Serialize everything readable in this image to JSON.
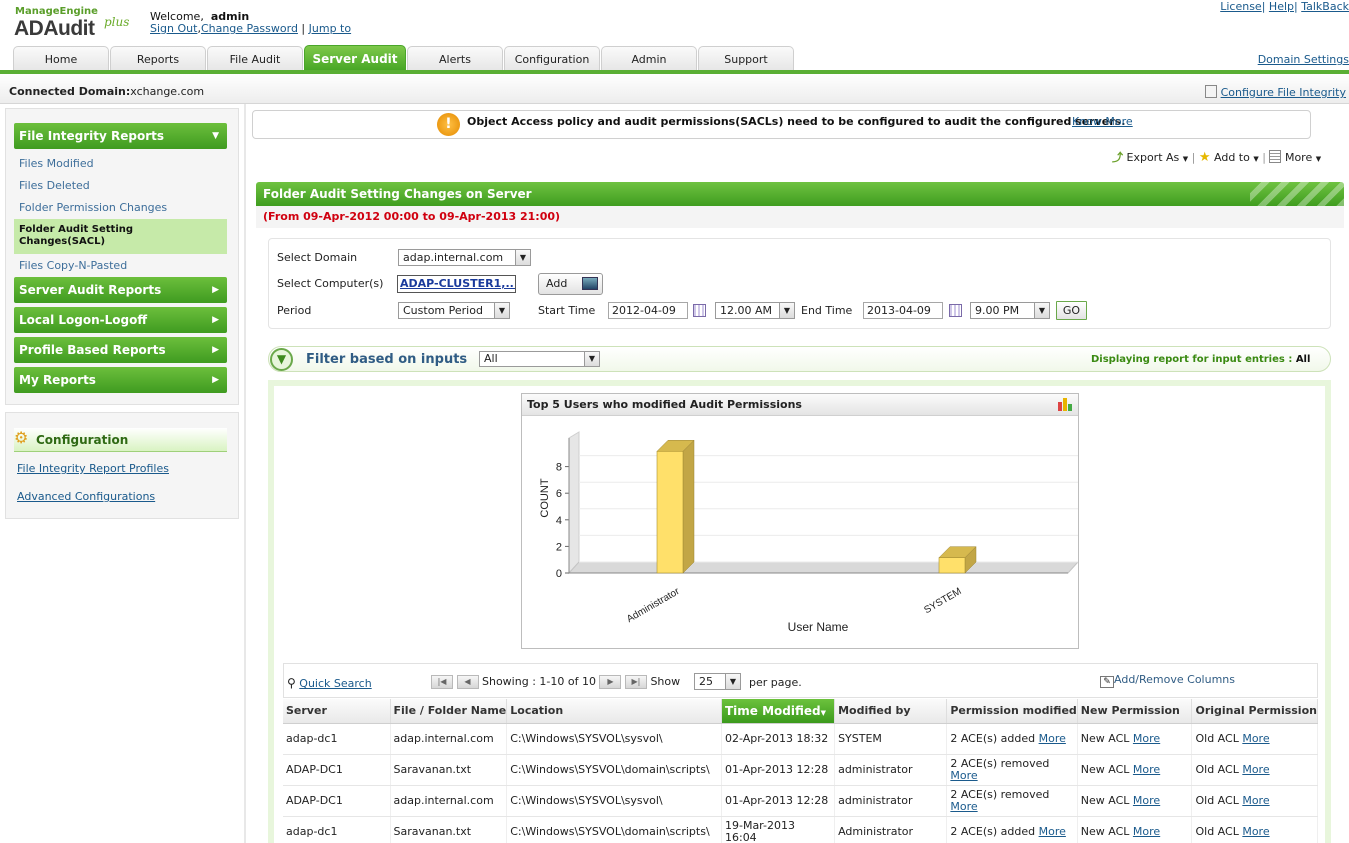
{
  "header": {
    "brand_top": "ManageEngine",
    "brand_main": "ADAudit",
    "brand_plus": "plus",
    "welcome_label": "Welcome,",
    "username": "admin",
    "sign_out": "Sign Out",
    "change_password": "Change Password",
    "jump_to": "Jump to",
    "license": "License",
    "help": "Help",
    "talkback": "TalkBack",
    "domain_settings": "Domain Settings"
  },
  "tabs": [
    {
      "label": "Home"
    },
    {
      "label": "Reports"
    },
    {
      "label": "File Audit"
    },
    {
      "label": "Server Audit",
      "active": true
    },
    {
      "label": "Alerts"
    },
    {
      "label": "Configuration"
    },
    {
      "label": "Admin"
    },
    {
      "label": "Support"
    }
  ],
  "connbar": {
    "label": "Connected Domain:",
    "domain": "xchange.com",
    "configure_link": "Configure File Integrity"
  },
  "sidebar": {
    "file_integrity_header": "File Integrity Reports",
    "items": [
      {
        "label": "Files Modified"
      },
      {
        "label": "Files Deleted"
      },
      {
        "label": "Folder Permission Changes"
      },
      {
        "label": "Folder Audit Setting Changes(SACL)",
        "selected": true
      },
      {
        "label": "Files Copy-N-Pasted"
      }
    ],
    "sections": [
      {
        "label": "Server Audit Reports"
      },
      {
        "label": "Local Logon-Logoff"
      },
      {
        "label": "Profile Based Reports"
      },
      {
        "label": "My Reports"
      }
    ],
    "configuration": {
      "title": "Configuration",
      "links": [
        "File Integrity Report Profiles",
        "Advanced Configurations"
      ]
    }
  },
  "notice": {
    "text": "Object Access policy and audit permissions(SACLs) need to be configured to audit the configured servers.",
    "link": "Know More"
  },
  "actions": {
    "export": "Export As",
    "add_to": "Add to",
    "more": "More"
  },
  "report": {
    "title": "Folder Audit Setting Changes on Server",
    "date_range": "(From 09-Apr-2012 00:00 to 09-Apr-2013 21:00)"
  },
  "form": {
    "domain_label": "Select Domain",
    "domain_value": "adap.internal.com",
    "computer_label": "Select Computer(s)",
    "computer_value": "ADAP-CLUSTER1,...",
    "add_button": "Add",
    "period_label": "Period",
    "period_value": "Custom Period",
    "start_label": "Start Time",
    "start_date": "2012-04-09",
    "start_time": "12.00 AM",
    "end_label": "End Time",
    "end_date": "2013-04-09",
    "end_time": "9.00 PM",
    "go_button": "GO"
  },
  "filter": {
    "label": "Filter based on inputs",
    "value": "All",
    "display_label": "Displaying report for input entries :",
    "display_value": "All"
  },
  "chart_data": {
    "type": "bar",
    "title": "Top 5 Users who modified Audit Permissions",
    "categories": [
      "Administrator",
      "SYSTEM"
    ],
    "values": [
      9,
      1
    ],
    "xlabel": "User Name",
    "ylabel": "COUNT",
    "ylim": [
      0,
      10
    ],
    "yticks": [
      0,
      2,
      4,
      6,
      8
    ],
    "bar_color": "#ffe06a",
    "grid": true
  },
  "table": {
    "quick_search": "Quick Search",
    "showing": "Showing : 1-10 of 10",
    "show_label": "Show",
    "page_size": "25",
    "per_page": "per page.",
    "add_remove_columns": "Add/Remove Columns",
    "columns": [
      "Server",
      "File / Folder Name",
      "Location",
      "Time Modified",
      "Modified by",
      "Permission modified",
      "New Permission",
      "Original Permission"
    ],
    "more_link": "More",
    "rows": [
      {
        "server": "adap-dc1",
        "file": "adap.internal.com",
        "location": "C:\\Windows\\SYSVOL\\sysvol\\",
        "time": "02-Apr-2013 18:32",
        "by": "SYSTEM",
        "perm": "2 ACE(s) added",
        "newp": "New ACL",
        "origp": "Old ACL"
      },
      {
        "server": "ADAP-DC1",
        "file": "Saravanan.txt",
        "location": "C:\\Windows\\SYSVOL\\domain\\scripts\\",
        "time": "01-Apr-2013 12:28",
        "by": "administrator",
        "perm": "2 ACE(s) removed",
        "newp": "New ACL",
        "origp": "Old ACL"
      },
      {
        "server": "ADAP-DC1",
        "file": "adap.internal.com",
        "location": "C:\\Windows\\SYSVOL\\sysvol\\",
        "time": "01-Apr-2013 12:28",
        "by": "administrator",
        "perm": "2 ACE(s) removed",
        "newp": "New ACL",
        "origp": "Old ACL"
      },
      {
        "server": "adap-dc1",
        "file": "Saravanan.txt",
        "location": "C:\\Windows\\SYSVOL\\domain\\scripts\\",
        "time": "19-Mar-2013 16:04",
        "by": "Administrator",
        "perm": "2 ACE(s) added",
        "newp": "New ACL",
        "origp": "Old ACL"
      }
    ]
  }
}
